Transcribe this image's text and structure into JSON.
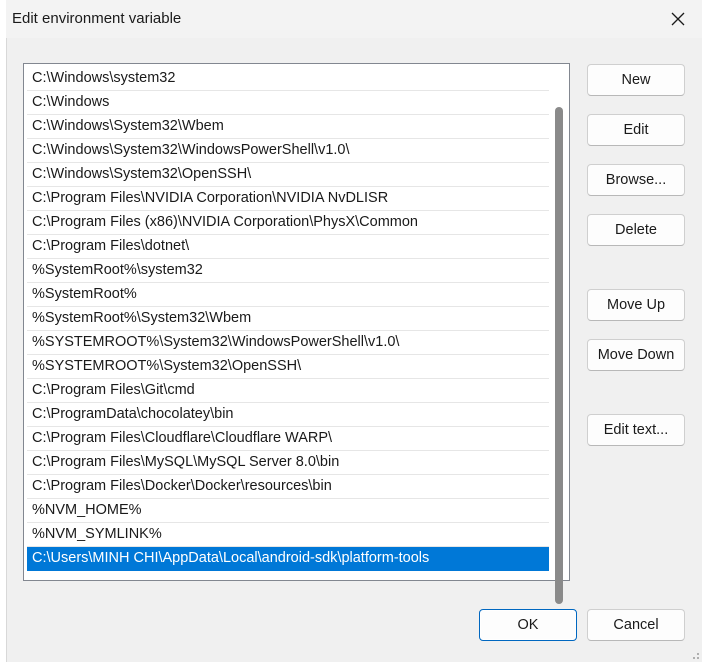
{
  "dialog": {
    "title": "Edit environment variable",
    "close_icon": "close-icon"
  },
  "list": {
    "items": [
      "C:\\Windows\\system32",
      "C:\\Windows",
      "C:\\Windows\\System32\\Wbem",
      "C:\\Windows\\System32\\WindowsPowerShell\\v1.0\\",
      "C:\\Windows\\System32\\OpenSSH\\",
      "C:\\Program Files\\NVIDIA Corporation\\NVIDIA NvDLISR",
      "C:\\Program Files (x86)\\NVIDIA Corporation\\PhysX\\Common",
      "C:\\Program Files\\dotnet\\",
      "%SystemRoot%\\system32",
      "%SystemRoot%",
      "%SystemRoot%\\System32\\Wbem",
      "%SYSTEMROOT%\\System32\\WindowsPowerShell\\v1.0\\",
      "%SYSTEMROOT%\\System32\\OpenSSH\\",
      "C:\\Program Files\\Git\\cmd",
      "C:\\ProgramData\\chocolatey\\bin",
      "C:\\Program Files\\Cloudflare\\Cloudflare WARP\\",
      "C:\\Program Files\\MySQL\\MySQL Server 8.0\\bin",
      "C:\\Program Files\\Docker\\Docker\\resources\\bin",
      "%NVM_HOME%",
      "%NVM_SYMLINK%",
      "C:\\Users\\MINH CHI\\AppData\\Local\\android-sdk\\platform-tools"
    ],
    "selected_index": 20
  },
  "buttons": {
    "new": "New",
    "edit": "Edit",
    "browse": "Browse...",
    "delete": "Delete",
    "move_up": "Move Up",
    "move_down": "Move Down",
    "edit_text": "Edit text...",
    "ok": "OK",
    "cancel": "Cancel"
  },
  "colors": {
    "selection": "#0078d7",
    "ok_border": "#0067c0",
    "background": "#f0f0f0"
  }
}
